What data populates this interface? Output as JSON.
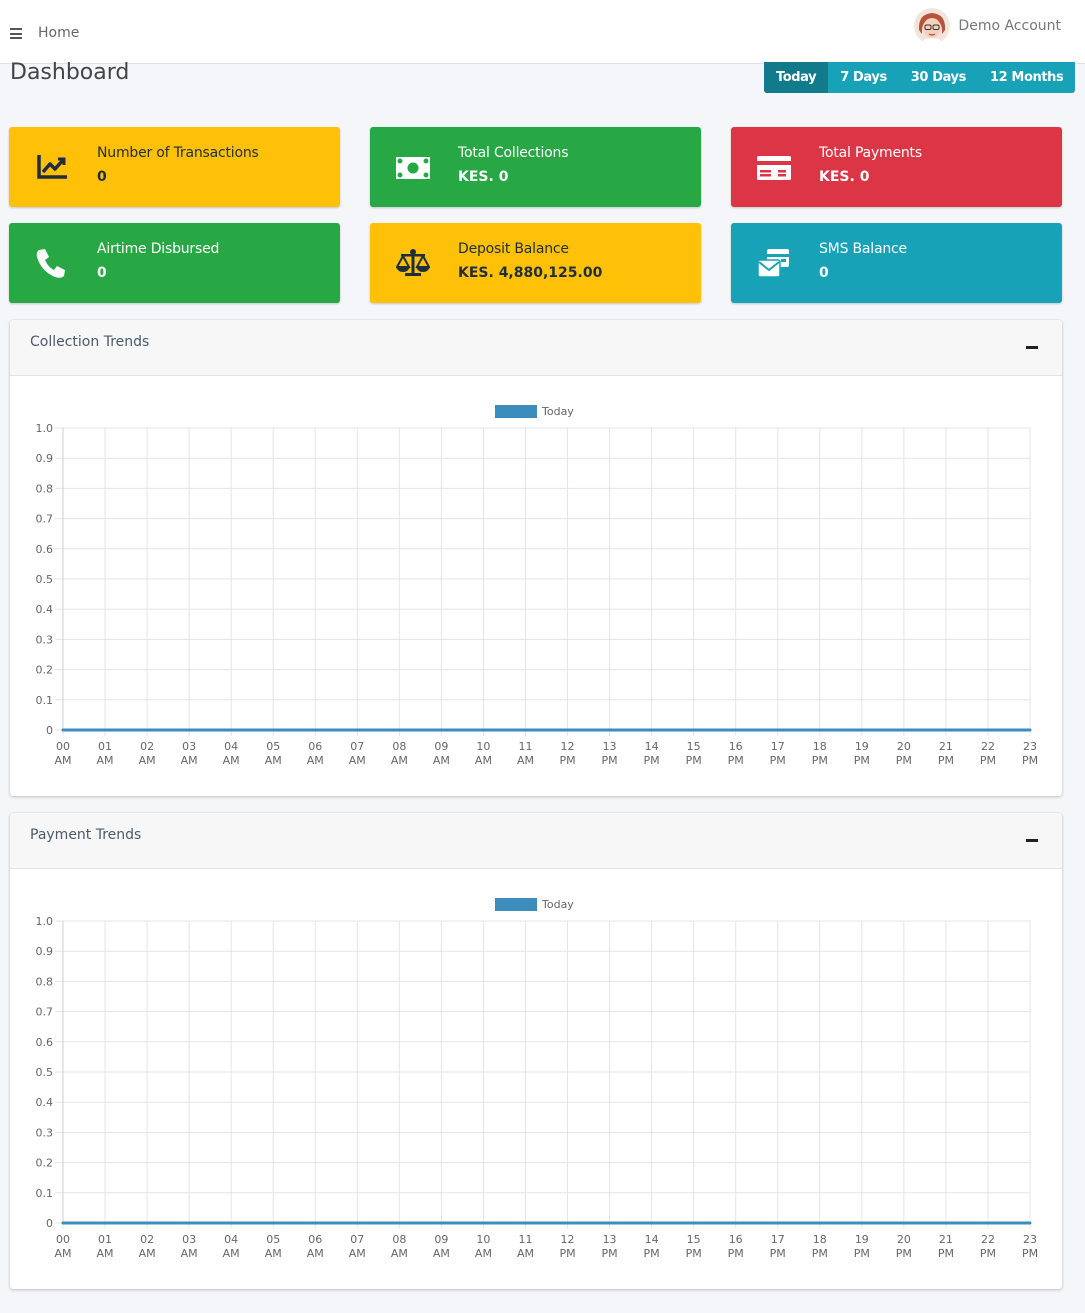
{
  "nav": {
    "home_label": "Home",
    "account_name": "Demo Account"
  },
  "page": {
    "title": "Dashboard"
  },
  "range_buttons": [
    {
      "label": "Today",
      "active": true
    },
    {
      "label": "7 Days",
      "active": false
    },
    {
      "label": "30 Days",
      "active": false
    },
    {
      "label": "12 Months",
      "active": false
    }
  ],
  "cards": [
    {
      "label": "Number of Transactions",
      "value": "0",
      "icon": "chart-line-icon",
      "color": "#ffc107"
    },
    {
      "label": "Total Collections",
      "value": "KES. 0",
      "icon": "money-bill-icon",
      "color": "#28a745"
    },
    {
      "label": "Total Payments",
      "value": "KES. 0",
      "icon": "credit-card-icon",
      "color": "#dc3545"
    },
    {
      "label": "Airtime Disbursed",
      "value": "0",
      "icon": "phone-icon",
      "color": "#28a745"
    },
    {
      "label": "Deposit Balance",
      "value": "KES. 4,880,125.00",
      "icon": "balance-scale-icon",
      "color": "#ffc107"
    },
    {
      "label": "SMS Balance",
      "value": "0",
      "icon": "envelope-card-icon",
      "color": "#17a2b8"
    }
  ],
  "panels": [
    {
      "title": "Collection Trends"
    },
    {
      "title": "Payment Trends"
    }
  ],
  "chart_data": [
    {
      "type": "line",
      "title": "",
      "categories": [
        "00 AM",
        "01 AM",
        "02 AM",
        "03 AM",
        "04 AM",
        "05 AM",
        "06 AM",
        "07 AM",
        "08 AM",
        "09 AM",
        "10 AM",
        "11 AM",
        "12 PM",
        "13 PM",
        "14 PM",
        "15 PM",
        "16 PM",
        "17 PM",
        "18 PM",
        "19 PM",
        "20 PM",
        "21 PM",
        "22 PM",
        "23 PM"
      ],
      "series": [
        {
          "name": "Today",
          "values": [
            0,
            0,
            0,
            0,
            0,
            0,
            0,
            0,
            0,
            0,
            0,
            0,
            0,
            0,
            0,
            0,
            0,
            0,
            0,
            0,
            0,
            0,
            0,
            0
          ],
          "color": "#3c8dbc"
        }
      ],
      "yticks": [
        "0",
        "0.1",
        "0.2",
        "0.3",
        "0.4",
        "0.5",
        "0.6",
        "0.7",
        "0.8",
        "0.9",
        "1.0"
      ],
      "ylim": [
        0,
        1
      ],
      "grid": true,
      "legend": "top-center"
    },
    {
      "type": "line",
      "title": "",
      "categories": [
        "00 AM",
        "01 AM",
        "02 AM",
        "03 AM",
        "04 AM",
        "05 AM",
        "06 AM",
        "07 AM",
        "08 AM",
        "09 AM",
        "10 AM",
        "11 AM",
        "12 PM",
        "13 PM",
        "14 PM",
        "15 PM",
        "16 PM",
        "17 PM",
        "18 PM",
        "19 PM",
        "20 PM",
        "21 PM",
        "22 PM",
        "23 PM"
      ],
      "series": [
        {
          "name": "Today",
          "values": [
            0,
            0,
            0,
            0,
            0,
            0,
            0,
            0,
            0,
            0,
            0,
            0,
            0,
            0,
            0,
            0,
            0,
            0,
            0,
            0,
            0,
            0,
            0,
            0
          ],
          "color": "#3c8dbc"
        }
      ],
      "yticks": [
        "0",
        "0.1",
        "0.2",
        "0.3",
        "0.4",
        "0.5",
        "0.6",
        "0.7",
        "0.8",
        "0.9",
        "1.0"
      ],
      "ylim": [
        0,
        1
      ],
      "grid": true,
      "legend": "top-center"
    }
  ]
}
